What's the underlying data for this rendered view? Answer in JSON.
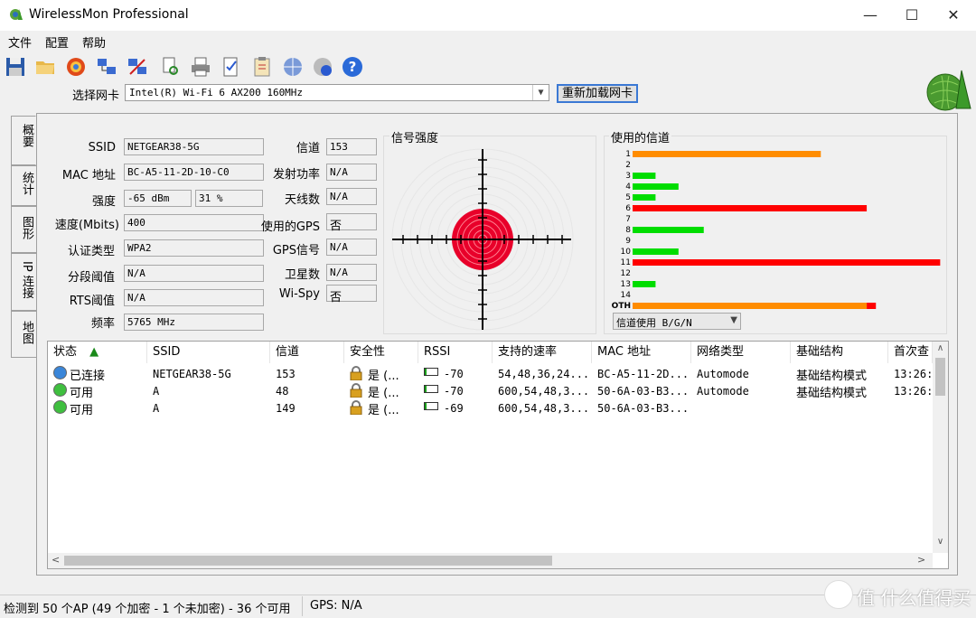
{
  "window": {
    "title": "WirelessMon Professional"
  },
  "menu": [
    "文件",
    "配置",
    "帮助"
  ],
  "toolbar_icons": [
    "save-icon",
    "open-folder-icon",
    "target-icon",
    "network-icon",
    "network-alert-icon",
    "print-preview-icon",
    "print-icon",
    "checklist-icon",
    "clipboard-icon",
    "globe-network-icon",
    "info-icon",
    "help-icon"
  ],
  "adapter": {
    "label": "选择网卡",
    "value": "Intel(R) Wi-Fi 6 AX200 160MHz",
    "reload": "重新加载网卡"
  },
  "tabs": [
    "概要",
    "统计",
    "图形",
    "IP 连接",
    "地图"
  ],
  "summary": {
    "ssid_label": "SSID",
    "ssid": "NETGEAR38-5G",
    "mac_label": "MAC 地址",
    "mac": "BC-A5-11-2D-10-C0",
    "strength_label": "强度",
    "strength_dbm": "-65 dBm",
    "strength_pct": "31 %",
    "speed_label": "速度(Mbits)",
    "speed": "400",
    "auth_label": "认证类型",
    "auth": "WPA2",
    "frag_label": "分段阈值",
    "frag": "N/A",
    "rts_label": "RTS阈值",
    "rts": "N/A",
    "freq_label": "频率",
    "freq": "5765 MHz",
    "channel_label": "信道",
    "channel": "153",
    "txpower_label": "发射功率",
    "txpower": "N/A",
    "antennas_label": "天线数",
    "antennas": "N/A",
    "gps_used_label": "使用的GPS",
    "gps_used": "否",
    "gps_signal_label": "GPS信号",
    "gps_signal": "N/A",
    "satellites_label": "卫星数",
    "satellites": "N/A",
    "wispy_label": "Wi-Spy",
    "wispy": "否"
  },
  "signal": {
    "title": "信号强度"
  },
  "channels": {
    "title": "使用的信道",
    "select": "信道使用 B/G/N",
    "rows": [
      {
        "label": "1",
        "level": 0.82,
        "color": "#ff8c00"
      },
      {
        "label": "2",
        "level": 0,
        "color": "#00dd00"
      },
      {
        "label": "3",
        "level": 0.1,
        "color": "#00dd00"
      },
      {
        "label": "4",
        "level": 0.2,
        "color": "#00dd00"
      },
      {
        "label": "5",
        "level": 0.1,
        "color": "#00dd00"
      },
      {
        "label": "6",
        "level": 1.02,
        "color": "#ff0000"
      },
      {
        "label": "7",
        "level": 0,
        "color": "#00dd00"
      },
      {
        "label": "8",
        "level": 0.31,
        "color": "#00dd00"
      },
      {
        "label": "9",
        "level": 0,
        "color": "#00dd00"
      },
      {
        "label": "10",
        "level": 0.2,
        "color": "#00dd00"
      },
      {
        "label": "11",
        "level": 1.34,
        "color": "#ff0000"
      },
      {
        "label": "12",
        "level": 0,
        "color": "#00dd00"
      },
      {
        "label": "13",
        "level": 0.1,
        "color": "#00dd00"
      },
      {
        "label": "14",
        "level": 0,
        "color": "#00dd00"
      },
      {
        "label": "OTH",
        "level": 1.02,
        "color": "#ff8c00",
        "tail": 0.04
      }
    ]
  },
  "list": {
    "columns": [
      "状态",
      "SSID",
      "信道",
      "安全性",
      "RSSI",
      "支持的速率",
      "MAC 地址",
      "网络类型",
      "基础结构",
      "首次查"
    ],
    "rows": [
      {
        "status": "已连接",
        "dot": "#3a86d9",
        "ssid": "NETGEAR38-5G",
        "channel": "153",
        "security": "是 (...",
        "rssi": "-70",
        "rssi_level": 0.15,
        "rates": "54,48,36,24...",
        "mac": "BC-A5-11-2D...",
        "nettype": "Automode",
        "infra": "基础结构模式",
        "first": "13:26:"
      },
      {
        "status": "可用",
        "dot": "#3fbf3f",
        "ssid": "A",
        "channel": "48",
        "security": "是 (...",
        "rssi": "-70",
        "rssi_level": 0.15,
        "rates": "600,54,48,3...",
        "mac": "50-6A-03-B3...",
        "nettype": "Automode",
        "infra": "基础结构模式",
        "first": "13:26:"
      },
      {
        "status": "可用",
        "dot": "#3fbf3f",
        "ssid": "A",
        "channel": "149",
        "security": "是 (...",
        "rssi": "-69",
        "rssi_level": 0.15,
        "rates": "600,54,48,3...",
        "mac": "50-6A-03-B3...",
        "nettype": "",
        "infra": "",
        "first": ""
      }
    ]
  },
  "status": {
    "left": "检测到 50 个AP (49 个加密 - 1 个未加密) - 36 个可用",
    "gps": "GPS: N/A"
  },
  "watermark": "值 什么值得买"
}
